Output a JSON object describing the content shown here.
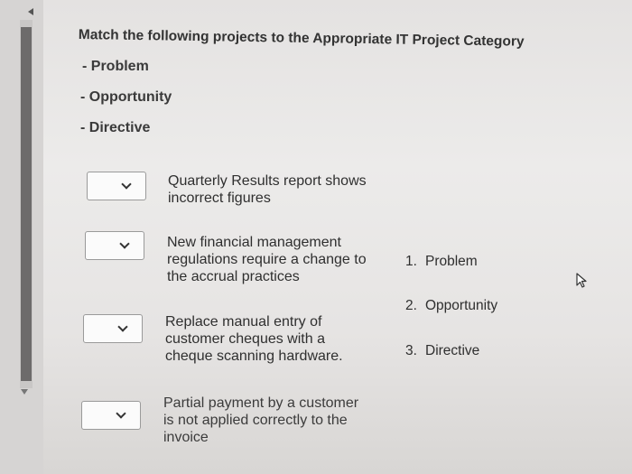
{
  "question": {
    "title": "Match the following projects to the Appropriate IT Project Category",
    "categories": [
      "- Problem",
      "- Opportunity",
      "- Directive"
    ]
  },
  "items": [
    {
      "line1": "Quarterly Results report shows",
      "line2": "incorrect figures",
      "line3": ""
    },
    {
      "line1": "New financial management",
      "line2": "regulations require a change to",
      "line3": "the accrual practices"
    },
    {
      "line1": "Replace manual entry of",
      "line2": "customer cheques with a",
      "line3": "cheque scanning hardware."
    },
    {
      "line1": "Partial payment by a customer",
      "line2": "is not applied correctly to the",
      "line3": "invoice"
    }
  ],
  "answers": [
    {
      "num": "1.",
      "label": "Problem"
    },
    {
      "num": "2.",
      "label": "Opportunity"
    },
    {
      "num": "3.",
      "label": "Directive"
    }
  ],
  "icons": {
    "dropdown": "chevron-down-icon",
    "cursor": "mouse-pointer-icon",
    "scroll_up": "scroll-up-arrow-icon",
    "scroll_down": "scroll-down-arrow-icon"
  }
}
